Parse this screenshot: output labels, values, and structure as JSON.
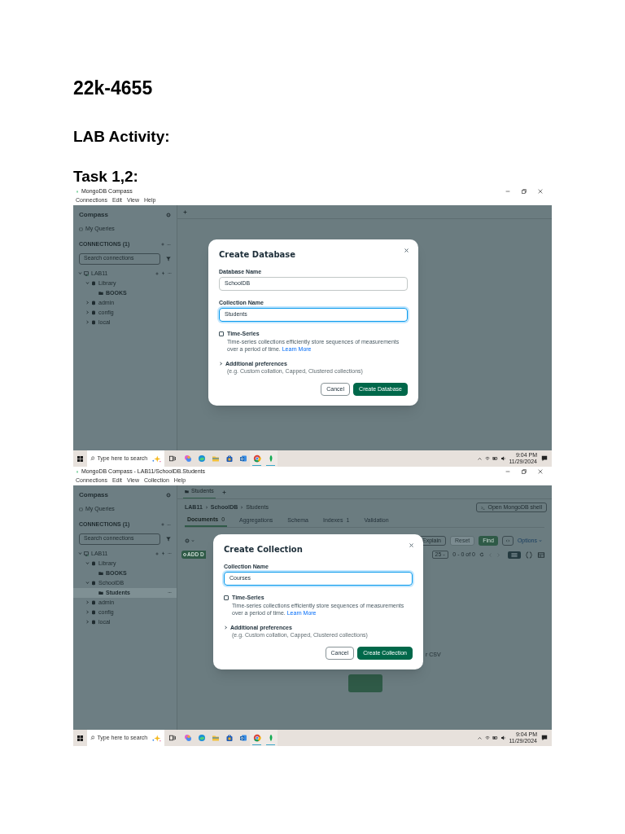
{
  "heading": "22k-4655",
  "section": "LAB Activity:",
  "task": "Task 1,2:",
  "screenshots": [
    {
      "window_title": "MongoDB Compass",
      "menu": [
        "Connections",
        "Edit",
        "View",
        "Help"
      ],
      "sidebar": {
        "title": "Compass",
        "my_queries": "My Queries",
        "connections_header": "CONNECTIONS (1)",
        "search_placeholder": "Search connections",
        "tree": [
          {
            "label": "LAB11",
            "kind": "connection",
            "expanded": true,
            "selected": false,
            "children": [
              {
                "label": "Library",
                "kind": "database",
                "expanded": true,
                "selected": false,
                "children": [
                  {
                    "label": "BOOKS",
                    "kind": "collection",
                    "selected": false
                  }
                ]
              },
              {
                "label": "admin",
                "kind": "database",
                "expanded": false,
                "selected": false
              },
              {
                "label": "config",
                "kind": "database",
                "expanded": false,
                "selected": false
              },
              {
                "label": "local",
                "kind": "database",
                "expanded": false,
                "selected": false
              }
            ]
          }
        ]
      },
      "modal": {
        "title": "Create Database",
        "fields": [
          {
            "label": "Database Name",
            "value": "SchoolDB",
            "focused": false
          },
          {
            "label": "Collection Name",
            "value": "Students",
            "focused": true
          }
        ],
        "time_series": {
          "label": "Time-Series",
          "checked": false,
          "description": "Time-series collections efficiently store sequences of measurements over a period of time.",
          "link": "Learn More"
        },
        "additional": {
          "label": "Additional preferences",
          "hint": "(e.g. Custom collation, Capped, Clustered collections)",
          "expanded": false
        },
        "buttons": [
          {
            "label": "Cancel",
            "kind": "secondary"
          },
          {
            "label": "Create Database",
            "kind": "primary"
          }
        ]
      },
      "taskbar": {
        "search_placeholder": "Type here to search",
        "apps": [
          {
            "kind": "copilot",
            "running": false
          },
          {
            "kind": "edge",
            "running": false
          },
          {
            "kind": "files",
            "running": false
          },
          {
            "kind": "store",
            "running": false
          },
          {
            "kind": "outlook",
            "running": false
          },
          {
            "kind": "chrome",
            "running": true
          },
          {
            "kind": "compass",
            "running": true
          }
        ],
        "time": "9:04 PM",
        "date": "11/29/2024"
      }
    },
    {
      "window_title": "MongoDB Compass - LAB11/SchoolDB.Students",
      "menu": [
        "Connections",
        "Edit",
        "View",
        "Collection",
        "Help"
      ],
      "sidebar": {
        "title": "Compass",
        "my_queries": "My Queries",
        "connections_header": "CONNECTIONS (1)",
        "search_placeholder": "Search connections",
        "tree": [
          {
            "label": "LAB11",
            "kind": "connection",
            "expanded": true,
            "selected": false,
            "children": [
              {
                "label": "Library",
                "kind": "database",
                "expanded": true,
                "selected": false,
                "children": [
                  {
                    "label": "BOOKS",
                    "kind": "collection",
                    "selected": false
                  }
                ]
              },
              {
                "label": "SchoolDB",
                "kind": "database",
                "expanded": true,
                "selected": false,
                "children": [
                  {
                    "label": "Students",
                    "kind": "collection",
                    "selected": true
                  }
                ]
              },
              {
                "label": "admin",
                "kind": "database",
                "expanded": false,
                "selected": false
              },
              {
                "label": "config",
                "kind": "database",
                "expanded": false,
                "selected": false
              },
              {
                "label": "local",
                "kind": "database",
                "expanded": false,
                "selected": false
              }
            ]
          }
        ]
      },
      "workspace": {
        "tabs": [
          {
            "label": "Students",
            "selected": true
          }
        ],
        "breadcrumb": [
          "LAB11",
          "SchoolDB",
          "Students"
        ],
        "shell_button": "Open MongoDB shell",
        "view_tabs": [
          {
            "label": "Documents",
            "count": "0",
            "selected": true
          },
          {
            "label": "Aggregations",
            "selected": false
          },
          {
            "label": "Schema",
            "selected": false
          },
          {
            "label": "Indexes",
            "count": "1",
            "selected": false
          },
          {
            "label": "Validation",
            "selected": false
          }
        ],
        "query_buttons": [
          {
            "label": "Explain",
            "kind": "outline"
          },
          {
            "label": "Reset",
            "kind": "disabled"
          },
          {
            "label": "Find",
            "kind": "primary"
          }
        ],
        "options": "Options",
        "add_button": "ADD D",
        "page_size": "25",
        "range": "0 - 0 of 0",
        "import_hint": "r CSV"
      },
      "modal": {
        "title": "Create Collection",
        "fields": [
          {
            "label": "Collection Name",
            "value": "Courses",
            "focused": true
          }
        ],
        "time_series": {
          "label": "Time-Series",
          "checked": false,
          "description": "Time-series collections efficiently store sequences of measurements over a period of time.",
          "link": "Learn More"
        },
        "additional": {
          "label": "Additional preferences",
          "hint": "(e.g. Custom collation, Capped, Clustered collections)",
          "expanded": false
        },
        "buttons": [
          {
            "label": "Cancel",
            "kind": "secondary"
          },
          {
            "label": "Create Collection",
            "kind": "primary"
          }
        ]
      },
      "taskbar": {
        "search_placeholder": "Type here to search",
        "apps": [
          {
            "kind": "copilot",
            "running": false
          },
          {
            "kind": "edge",
            "running": false
          },
          {
            "kind": "files",
            "running": false
          },
          {
            "kind": "store",
            "running": false
          },
          {
            "kind": "outlook",
            "running": false
          },
          {
            "kind": "chrome",
            "running": true
          },
          {
            "kind": "compass",
            "running": true
          }
        ],
        "time": "9:04 PM",
        "date": "11/29/2024"
      }
    }
  ]
}
